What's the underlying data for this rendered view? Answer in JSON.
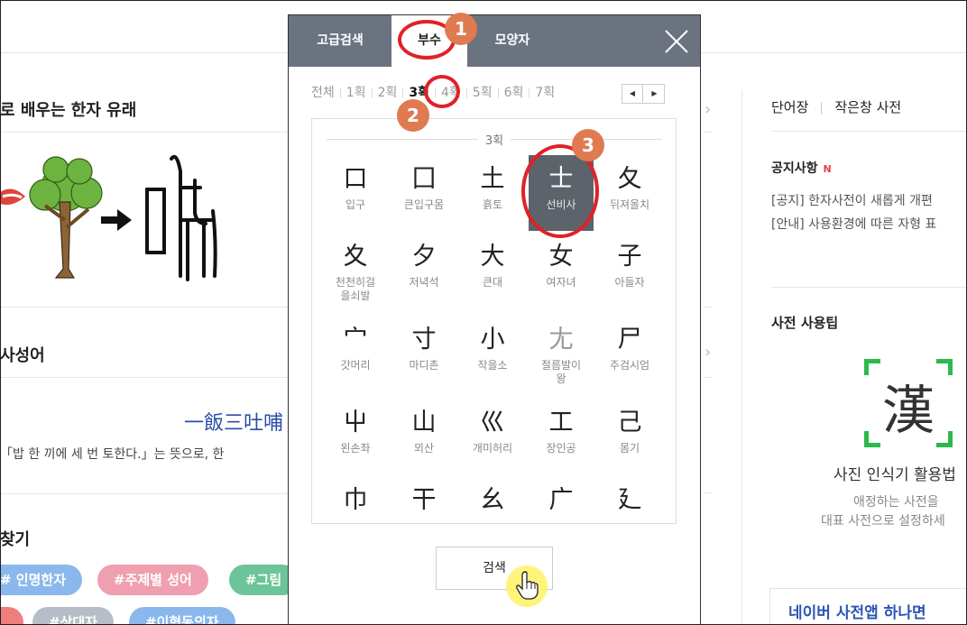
{
  "page": {
    "origin_title": "로 배우는 한자 유래",
    "idiom_title": "사성어",
    "idiom_hanzi": "一飯三吐哺",
    "idiom_desc": "「밥 한 끼에 세 번 토한다.」는 뜻으로, 한",
    "find_title": "찾기",
    "tags_row1": [
      "# 인명한자",
      "#주제별 성어",
      "#그림"
    ],
    "tags_row2": [
      "#상대자",
      "#이형동의자"
    ],
    "right_links": [
      "단어장",
      "작은창 사전"
    ],
    "notice_title": "공지사항",
    "notice_new": "N",
    "notices": [
      "[공지] 한자사전이 새롭게 개편",
      "[안내] 사용환경에 따른 자형 표"
    ],
    "tip_title": "사전 사용팁",
    "tip_han": "漢",
    "tip_caption": "사진 인식기 활용법",
    "tip_sub1": "애정하는 사전을",
    "tip_sub2": "대표 사전으로 설정하세",
    "app_banner": "네이버 사전앱 하나면"
  },
  "popup": {
    "tabs": [
      {
        "label": "고급검색",
        "active": false
      },
      {
        "label": "부수",
        "active": true
      },
      {
        "label": "모양자",
        "active": false
      }
    ],
    "close_icon": "close-icon",
    "strokes": [
      "전체",
      "1획",
      "2획",
      "3획",
      "4획",
      "5획",
      "6획",
      "7획"
    ],
    "active_stroke": "3획",
    "group_label": "3획",
    "radicals": [
      {
        "glyph": "口",
        "name": "입구"
      },
      {
        "glyph": "囗",
        "name": "큰입구몸"
      },
      {
        "glyph": "土",
        "name": "흙토"
      },
      {
        "glyph": "士",
        "name": "선비사",
        "selected": true
      },
      {
        "glyph": "夂",
        "name": "뒤져올치"
      },
      {
        "glyph": "夊",
        "name": "천천히걸\n을쇠발"
      },
      {
        "glyph": "夕",
        "name": "저녁석"
      },
      {
        "glyph": "大",
        "name": "큰대"
      },
      {
        "glyph": "女",
        "name": "여자녀"
      },
      {
        "glyph": "子",
        "name": "아들자"
      },
      {
        "glyph": "宀",
        "name": "갓머리"
      },
      {
        "glyph": "寸",
        "name": "마디촌"
      },
      {
        "glyph": "小",
        "name": "작을소"
      },
      {
        "glyph": "尢",
        "name": "절름발이\n왕",
        "faint": true
      },
      {
        "glyph": "尸",
        "name": "주검시엄"
      },
      {
        "glyph": "屮",
        "name": "왼손좌"
      },
      {
        "glyph": "山",
        "name": "뫼산"
      },
      {
        "glyph": "巛",
        "name": "개미허리"
      },
      {
        "glyph": "工",
        "name": "장인공"
      },
      {
        "glyph": "己",
        "name": "몸기"
      },
      {
        "glyph": "巾",
        "name": ""
      },
      {
        "glyph": "干",
        "name": ""
      },
      {
        "glyph": "幺",
        "name": ""
      },
      {
        "glyph": "广",
        "name": ""
      },
      {
        "glyph": "廴",
        "name": ""
      }
    ],
    "search_label": "검색"
  },
  "annotations": [
    "1",
    "2",
    "3"
  ],
  "colors": {
    "header": "#6b7380",
    "selected_cell": "#5d636b",
    "annotation_ring": "#e02127",
    "annotation_badge": "#e07a50",
    "accent_blue": "#2a4ea8",
    "tip_green": "#2db84d"
  }
}
